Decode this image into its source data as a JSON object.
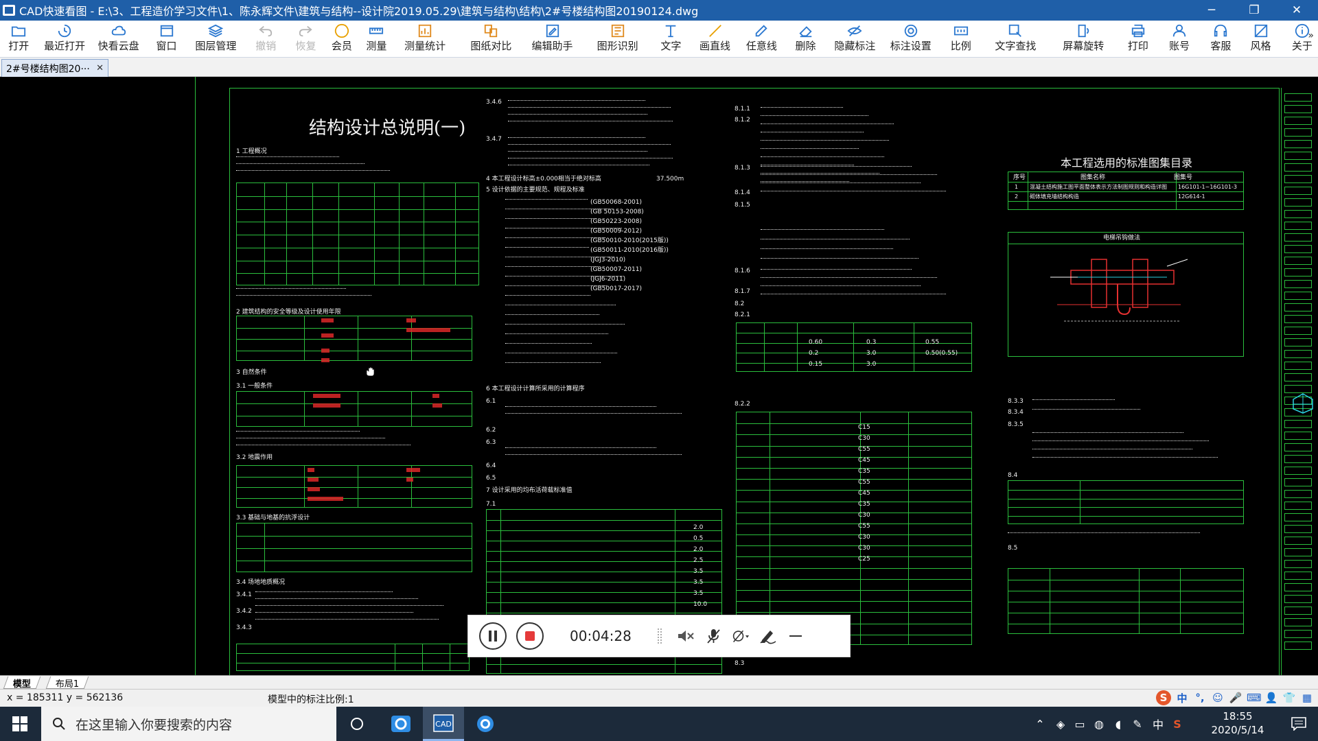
{
  "window": {
    "title": "CAD快速看图 - E:\\3、工程造价学习文件\\1、陈永辉文件\\建筑与结构--设计院2019.05.29\\建筑与结构\\结构\\2#号楼结构图20190124.dwg",
    "minimize": "─",
    "restore": "❐",
    "close": "✕"
  },
  "toolbar": {
    "items": [
      {
        "label": "打开",
        "icon": "folder-open-icon",
        "color": "#2b78d0",
        "enabled": true
      },
      {
        "label": "最近打开",
        "icon": "history-icon",
        "color": "#2b78d0",
        "enabled": true
      },
      {
        "label": "快看云盘",
        "icon": "cloud-icon",
        "color": "#2b78d0",
        "enabled": true
      },
      {
        "label": "窗口",
        "icon": "window-icon",
        "color": "#2b78d0",
        "enabled": true
      },
      {
        "label": "图层管理",
        "icon": "layers-icon",
        "color": "#2b78d0",
        "enabled": true
      },
      {
        "label": "撤销",
        "icon": "undo-icon",
        "color": "#b5b5b5",
        "enabled": false
      },
      {
        "label": "恢复",
        "icon": "redo-icon",
        "color": "#b5b5b5",
        "enabled": false
      },
      {
        "label": "会员",
        "icon": "vip-icon",
        "color": "#e8a000",
        "enabled": true
      },
      {
        "label": "测量",
        "icon": "ruler-icon",
        "color": "#2b78d0",
        "enabled": true
      },
      {
        "label": "测量统计",
        "icon": "measure-stats-icon",
        "color": "#e08a1e",
        "enabled": true
      },
      {
        "label": "图纸对比",
        "icon": "compare-icon",
        "color": "#e08a1e",
        "enabled": true
      },
      {
        "label": "编辑助手",
        "icon": "edit-assistant-icon",
        "color": "#2b78d0",
        "enabled": true
      },
      {
        "label": "图形识别",
        "icon": "recognize-icon",
        "color": "#e08a1e",
        "enabled": true
      },
      {
        "label": "文字",
        "icon": "text-icon",
        "color": "#2b78d0",
        "enabled": true
      },
      {
        "label": "画直线",
        "icon": "line-icon",
        "color": "#e8a000",
        "enabled": true
      },
      {
        "label": "任意线",
        "icon": "pen-icon",
        "color": "#2b78d0",
        "enabled": true
      },
      {
        "label": "删除",
        "icon": "eraser-icon",
        "color": "#2b78d0",
        "enabled": true
      },
      {
        "label": "隐藏标注",
        "icon": "eye-hide-icon",
        "color": "#2b78d0",
        "enabled": true
      },
      {
        "label": "标注设置",
        "icon": "annotation-settings-icon",
        "color": "#2b78d0",
        "enabled": true
      },
      {
        "label": "比例",
        "icon": "scale-icon",
        "color": "#2b78d0",
        "enabled": true
      },
      {
        "label": "文字查找",
        "icon": "text-search-icon",
        "color": "#2b78d0",
        "enabled": true
      },
      {
        "label": "屏幕旋转",
        "icon": "rotate-screen-icon",
        "color": "#2b78d0",
        "enabled": true
      },
      {
        "label": "打印",
        "icon": "printer-icon",
        "color": "#2b78d0",
        "enabled": true
      },
      {
        "label": "账号",
        "icon": "user-icon",
        "color": "#2b78d0",
        "enabled": true
      },
      {
        "label": "客服",
        "icon": "headset-icon",
        "color": "#2b78d0",
        "enabled": true
      },
      {
        "label": "风格",
        "icon": "style-icon",
        "color": "#2b78d0",
        "enabled": true
      },
      {
        "label": "关于",
        "icon": "info-icon",
        "color": "#2b78d0",
        "enabled": true
      }
    ],
    "more": "»"
  },
  "tabs": {
    "doc_tab_label": "2#号楼结构图20···",
    "doc_tab_close": "✕"
  },
  "drawing": {
    "main_title": "结构设计总说明(一)",
    "table_title": "本工程选用的标准图集目录",
    "detail_caption": "电梯吊钩做法",
    "left_col_headers": [
      "1  工程概况",
      "2  建筑结构的安全等级及设计使用年限",
      "3  自然条件",
      "3.1  一般条件",
      "3.2  地震作用",
      "3.3  基础与地基的抗浮设计",
      "3.4  场地地质概况"
    ],
    "left_col_heights": [
      "3.4.1",
      "3.4.2",
      "3.4.3"
    ],
    "mid_col_sections": [
      "3.4.6",
      "3.4.7",
      "4  本工程设计标高±0.000相当于绝对标高",
      "5  设计依据的主要规范、规程及标准",
      "6  本工程设计计算所采用的计算程序",
      "6.1",
      "6.2",
      "6.3",
      "6.4",
      "6.5",
      "7  设计采用的均布活荷载标准值",
      "7.1"
    ],
    "mid_value_elevation": "37.500m",
    "code_list": [
      "(GB50068-2001)",
      "(GB 50153-2008)",
      "(GB50223-2008)",
      "(GB50009-2012)",
      "(GB50010-2010(2015版))",
      "(GB50011-2010(2016版))",
      "(JGJ3-2010)",
      "(GB50007-2011)",
      "(JGJ6-2011)",
      "(GB50017-2017)"
    ],
    "right_col_sections": [
      "8.1.1",
      "8.1.2",
      "8.1.3",
      "8.1.4",
      "8.1.5",
      "8.1.6",
      "8.1.7",
      "8.2",
      "8.2.1",
      "8.2.2",
      "8.3"
    ],
    "far_right_sections": [
      "8.3.3",
      "8.3.4",
      "8.3.5",
      "8.4",
      "8.5"
    ],
    "atlas_table": {
      "headers": [
        "序号",
        "图集名称",
        "图集号"
      ],
      "rows": [
        [
          "1",
          "混凝土结构施工图平面整体表示方法制图规则和构造详图",
          "16G101-1~16G101-3"
        ],
        [
          "2",
          "砌体填充墙结构构造",
          "12G614-1"
        ]
      ]
    },
    "concrete_grades": [
      "C15",
      "C30",
      "C55",
      "C45",
      "C35",
      "C55",
      "C45",
      "C35",
      "C30",
      "C55",
      "C30",
      "C30",
      "C25"
    ],
    "live_load_values": [
      "2.0",
      "0.5",
      "2.0",
      "2.5",
      "3.5",
      "3.5",
      "3.5",
      "10.0"
    ],
    "env_table_values": [
      "0.60",
      "0.3",
      "0.55",
      "0.2",
      "3.0",
      "0.50(0.55)",
      "0.15",
      "3.0"
    ]
  },
  "recording": {
    "timer": "00:04:28",
    "pause_icon": "pause-icon",
    "stop_icon": "stop-icon",
    "mute_icon": "speaker-mute-icon",
    "mic_icon": "microphone-off-icon",
    "camera_icon": "camera-off-icon",
    "pen_icon": "annotate-pen-icon",
    "minimize_icon": "minimize-icon"
  },
  "layout_tabs": {
    "model": "模型",
    "layout1": "布局1"
  },
  "status": {
    "coords": "x = 185311  y = 562136",
    "scale_text": "模型中的标注比例:1",
    "ime_chars": [
      "中",
      "°,",
      "☺",
      "🎤",
      "⌨",
      "👤",
      "👕",
      "▦"
    ]
  },
  "taskbar": {
    "search_placeholder": "在这里输入你要搜索的内容",
    "apps": [
      "cortana-icon",
      "edge-browser-icon",
      "cad-viewer-icon",
      "video-app-icon"
    ],
    "tray": [
      "chevron-up-icon",
      "shield-icon",
      "battery-icon",
      "network-icon",
      "volume-icon",
      "pen-icon",
      "中",
      "s-ime-icon"
    ],
    "clock_time": "18:55",
    "clock_date": "2020/5/14"
  }
}
